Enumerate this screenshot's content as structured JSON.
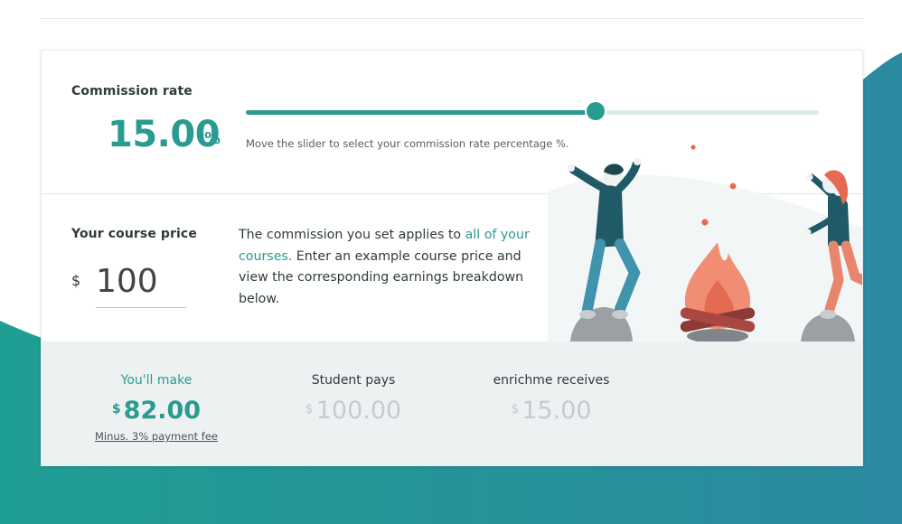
{
  "colors": {
    "accent": "#2a9b91",
    "muted": "#c5cbcd",
    "fire": "#e56a52",
    "figure_dark": "#1f5a66",
    "figure_legs": "#3f93ad",
    "figure_right": "#e8866d"
  },
  "commission": {
    "label": "Commission rate",
    "value": "15.00",
    "unit": "%",
    "slider_fraction": 0.61,
    "hint": "Move the slider to select your commission rate percentage %."
  },
  "course_price": {
    "label": "Your course price",
    "currency": "$",
    "value": "100"
  },
  "description": {
    "part1": "The commission you set applies to ",
    "highlight": "all of your courses.",
    "part2": " Enter an example course price and view the corresponding earnings breakdown below."
  },
  "breakdown": {
    "you_make": {
      "label": "You'll make",
      "currency": "$",
      "amount": "82.00",
      "fee_note": "Minus. 3% payment fee"
    },
    "student_pays": {
      "label": "Student pays",
      "currency": "$",
      "amount": "100.00"
    },
    "enrichme_receives": {
      "label": "enrichme receives",
      "currency": "$",
      "amount": "15.00"
    }
  },
  "illustration": {
    "name": "campfire-celebration-illustration"
  }
}
